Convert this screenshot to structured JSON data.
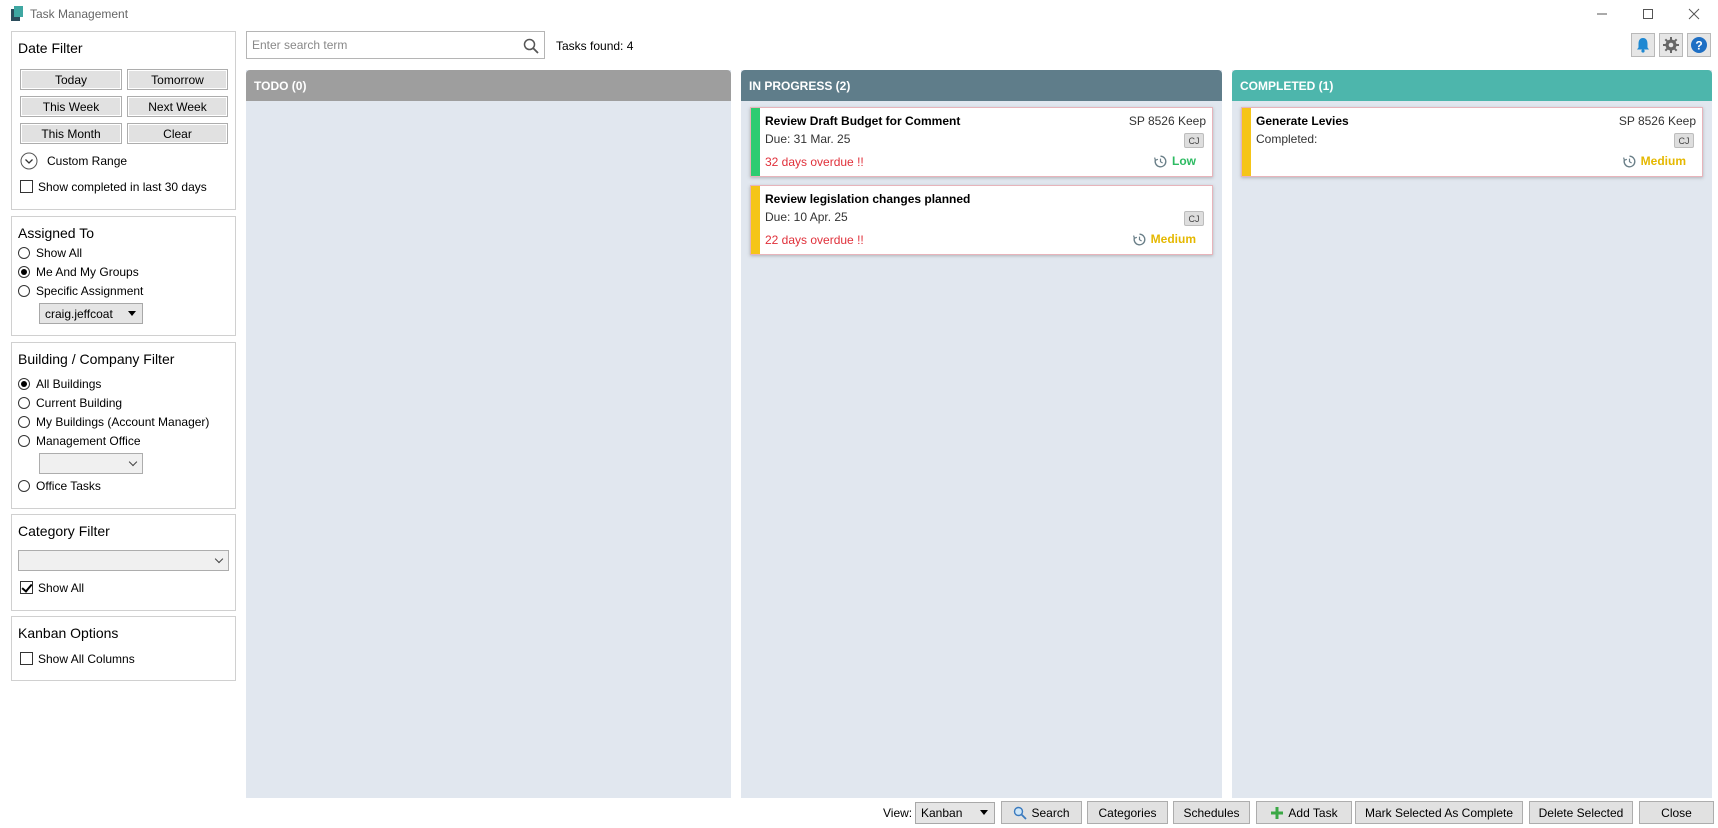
{
  "window": {
    "title": "Task Management"
  },
  "date_filter": {
    "title": "Date Filter",
    "buttons": {
      "today": "Today",
      "tomorrow": "Tomorrow",
      "this_week": "This Week",
      "next_week": "Next Week",
      "this_month": "This Month",
      "clear": "Clear"
    },
    "custom_range": "Custom Range",
    "show_completed": {
      "label": "Show completed in last 30 days",
      "checked": false
    }
  },
  "assigned_to": {
    "title": "Assigned To",
    "options": [
      "Show All",
      "Me And My Groups",
      "Specific Assignment"
    ],
    "selected": "Me And My Groups",
    "user": "craig.jeffcoat"
  },
  "building_filter": {
    "title": "Building / Company Filter",
    "options": [
      "All Buildings",
      "Current Building",
      "My Buildings (Account Manager)",
      "Management Office",
      "Office Tasks"
    ],
    "selected": "All Buildings",
    "office_value": ""
  },
  "category_filter": {
    "title": "Category Filter",
    "value": "",
    "show_all": {
      "label": "Show All",
      "checked": true
    }
  },
  "kanban_options": {
    "title": "Kanban Options",
    "show_all_columns": {
      "label": "Show All Columns",
      "checked": false
    }
  },
  "search": {
    "placeholder": "Enter search term",
    "tasks_found": "Tasks found: 4"
  },
  "columns": {
    "todo": {
      "title": "TODO (0)",
      "color": "#9e9e9e"
    },
    "in_progress": {
      "title": "IN PROGRESS (2)",
      "color": "#5f7d8a",
      "cards": [
        {
          "title": "Review Draft Budget for Comment",
          "building": "SP 8526 Keep",
          "due": "Due: 31 Mar. 25",
          "overdue": "32 days overdue !!",
          "initials": "CJ",
          "priority": "Low",
          "priority_color": "#2dbb62",
          "stripe_color": "#2ecc71"
        },
        {
          "title": "Review legislation changes planned",
          "building": "",
          "due": "Due: 10 Apr. 25",
          "overdue": "22 days overdue !!",
          "initials": "CJ",
          "priority": "Medium",
          "priority_color": "#e5b800",
          "stripe_color": "#f5c518"
        }
      ]
    },
    "completed": {
      "title": "COMPLETED (1)",
      "color": "#4db6ac",
      "cards": [
        {
          "title": "Generate Levies",
          "building": "SP 8526 Keep",
          "due": "Completed:",
          "overdue": "",
          "initials": "CJ",
          "priority": "Medium",
          "priority_color": "#e5b800",
          "stripe_color": "#f5c518"
        }
      ]
    }
  },
  "bottom_bar": {
    "view_label": "View:",
    "view_value": "Kanban",
    "search": "Search",
    "categories": "Categories",
    "schedules": "Schedules",
    "add_task": "Add Task",
    "mark_complete": "Mark Selected As Complete",
    "delete_selected": "Delete Selected",
    "close": "Close"
  },
  "icons": {
    "app": "app-logo-icon",
    "minimize": "minimize-icon",
    "maximize": "maximize-icon",
    "close": "close-icon",
    "search": "search-icon",
    "bell": "bell-icon",
    "gear": "gear-icon",
    "help": "help-icon",
    "clock": "clock-icon",
    "plus": "plus-icon"
  },
  "accent_color": "#1e88d2"
}
